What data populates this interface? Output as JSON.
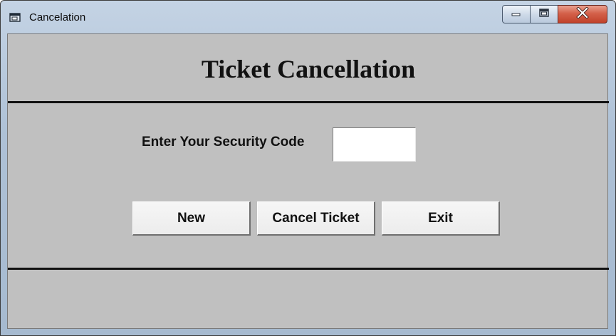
{
  "window": {
    "title": "Cancelation",
    "icon": "app-window-icon",
    "controls": {
      "minimize_icon": "minimize-icon",
      "maximize_icon": "maximize-icon",
      "close_icon": "close-icon"
    }
  },
  "form": {
    "heading": "Ticket Cancellation",
    "security_code": {
      "label": "Enter Your Security Code",
      "value": ""
    },
    "buttons": {
      "new_label": "New",
      "cancel_ticket_label": "Cancel Ticket",
      "exit_label": "Exit"
    }
  },
  "colors": {
    "form_background": "#c0c0c0",
    "close_button": "#c1412a"
  }
}
